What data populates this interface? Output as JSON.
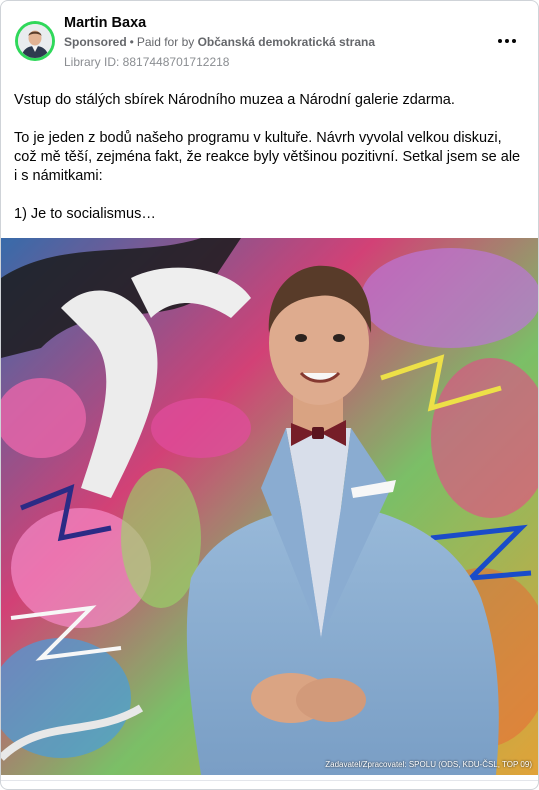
{
  "post": {
    "author": "Martin Baxa",
    "sponsored_label": "Sponsored",
    "separator": "•",
    "paid_for_prefix": "Paid for by",
    "paid_for_by": "Občanská demokratická strana",
    "library_id": "Library ID: 8817448701712218",
    "more_icon": "more-horizontal-icon",
    "avatar_ring_color": "#2fd85a",
    "paragraphs": [
      "Vstup do stálých sbírek Národního muzea a Národní galerie zdarma.",
      "To je jeden z bodů našeho programu v kultuře. Návrh vyvolal velkou diskuzi, což mě těší, zejména fakt, že reakce byly většinou pozitivní. Setkal jsem se ale i s námitkami:",
      "1) Je to socialismus…"
    ],
    "image_caption": "Zadavatel/Zpracovatel: SPOLU (ODS, KDU-ČSL, TOP 09)"
  }
}
